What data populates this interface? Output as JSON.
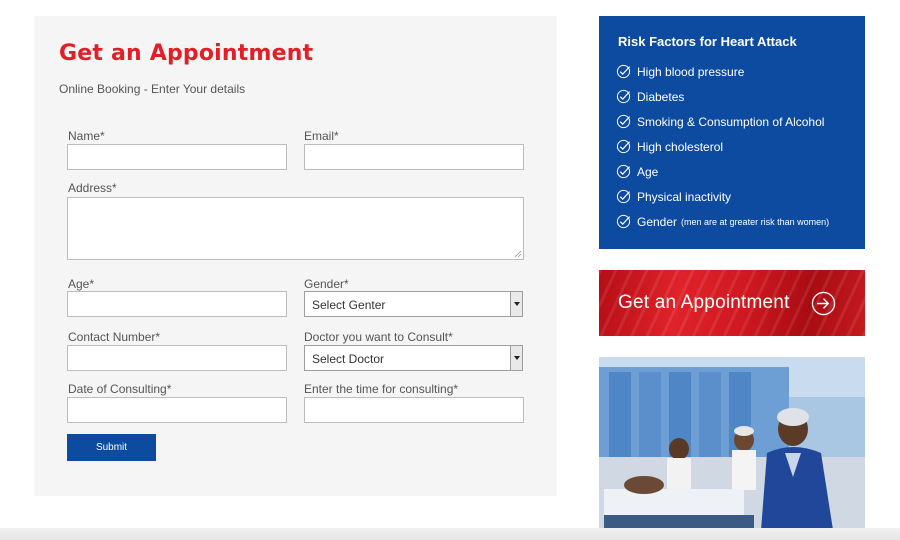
{
  "form": {
    "title": "Get an Appointment",
    "subtitle": "Online Booking - Enter Your details",
    "labels": {
      "name": "Name*",
      "email": "Email*",
      "address": "Address*",
      "age": "Age*",
      "gender": "Gender*",
      "contact": "Contact Number*",
      "doctor": "Doctor you want to Consult*",
      "date": "Date of Consulting*",
      "time": "Enter the time for consulting*"
    },
    "values": {
      "name": "",
      "email": "",
      "address": "",
      "age": "",
      "contact": "",
      "date": "",
      "time": ""
    },
    "gender_select": "Select Genter",
    "doctor_select": "Select Doctor",
    "submit_label": "Submit"
  },
  "risk": {
    "title": "Risk Factors for Heart Attack",
    "items": [
      {
        "label": "High blood pressure",
        "note": ""
      },
      {
        "label": "Diabetes",
        "note": ""
      },
      {
        "label": "Smoking & Consumption of Alcohol",
        "note": ""
      },
      {
        "label": "High cholesterol",
        "note": ""
      },
      {
        "label": "Age",
        "note": ""
      },
      {
        "label": "Physical inactivity",
        "note": ""
      },
      {
        "label": "Gender",
        "note": "(men are at greater risk than women)"
      }
    ],
    "icon": "check-circle-icon"
  },
  "banner": {
    "text": "Get an Appointment",
    "icon": "arrow-circle-icon"
  },
  "colors": {
    "accent_red": "#e41e26",
    "brand_blue": "#0d4ba0",
    "panel_bg": "#f5f5f5"
  }
}
